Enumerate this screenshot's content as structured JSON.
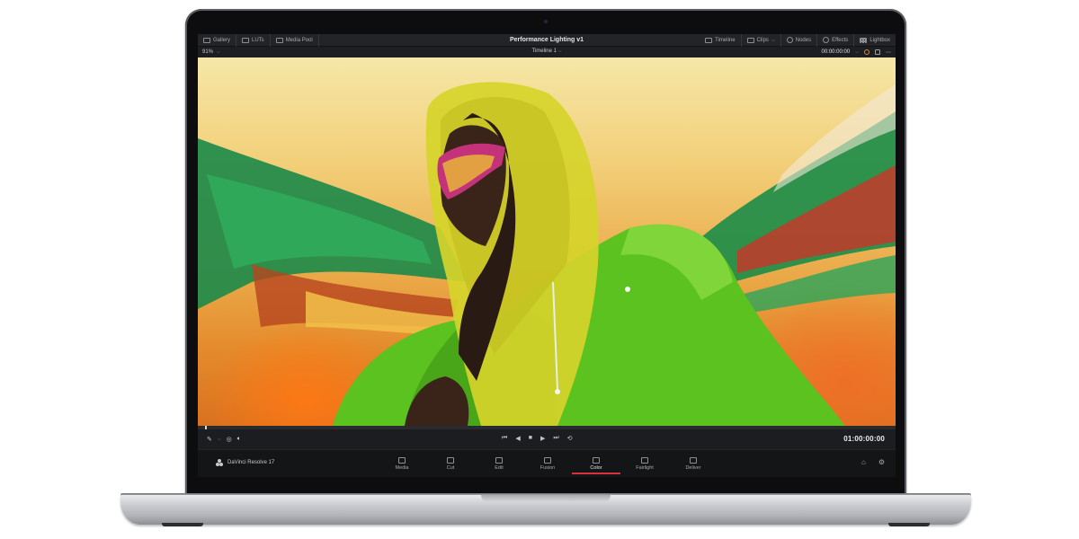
{
  "app": {
    "title": "Performance Lighting v1",
    "brand": "DaVinci Resolve 17"
  },
  "topbar": {
    "left": [
      {
        "label": "Gallery",
        "icon": "gallery-icon"
      },
      {
        "label": "LUTs",
        "icon": "luts-icon"
      },
      {
        "label": "Media Pool",
        "icon": "media-pool-icon"
      }
    ],
    "right": [
      {
        "label": "Timeline",
        "icon": "timeline-icon"
      },
      {
        "label": "Clips",
        "icon": "clips-icon"
      },
      {
        "label": "Nodes",
        "icon": "nodes-icon"
      },
      {
        "label": "Effects",
        "icon": "effects-icon"
      },
      {
        "label": "Lightbox",
        "icon": "lightbox-icon"
      }
    ]
  },
  "viewer": {
    "zoom": "91%",
    "timeline_name": "Timeline 1",
    "source_timecode": "00:00:00:00",
    "timecode": "01:00:00:00",
    "playhead_fraction": 0.01
  },
  "transport": {
    "buttons": [
      {
        "name": "go-to-start-icon",
        "glyph": "⏮"
      },
      {
        "name": "play-reverse-icon",
        "glyph": "◀"
      },
      {
        "name": "stop-icon",
        "glyph": "■"
      },
      {
        "name": "play-icon",
        "glyph": "▶"
      },
      {
        "name": "go-to-end-icon",
        "glyph": "⏭"
      },
      {
        "name": "loop-icon",
        "glyph": "⟲"
      }
    ]
  },
  "pages": [
    {
      "label": "Media",
      "icon": "media-page-icon",
      "active": false
    },
    {
      "label": "Cut",
      "icon": "cut-page-icon",
      "active": false
    },
    {
      "label": "Edit",
      "icon": "edit-page-icon",
      "active": false
    },
    {
      "label": "Fusion",
      "icon": "fusion-page-icon",
      "active": false
    },
    {
      "label": "Color",
      "icon": "color-page-icon",
      "active": true
    },
    {
      "label": "Fairlight",
      "icon": "fairlight-page-icon",
      "active": false
    },
    {
      "label": "Deliver",
      "icon": "deliver-page-icon",
      "active": false
    }
  ],
  "colors": {
    "active_page_accent": "#d8323a",
    "ui_dark": "#1c1d20"
  }
}
